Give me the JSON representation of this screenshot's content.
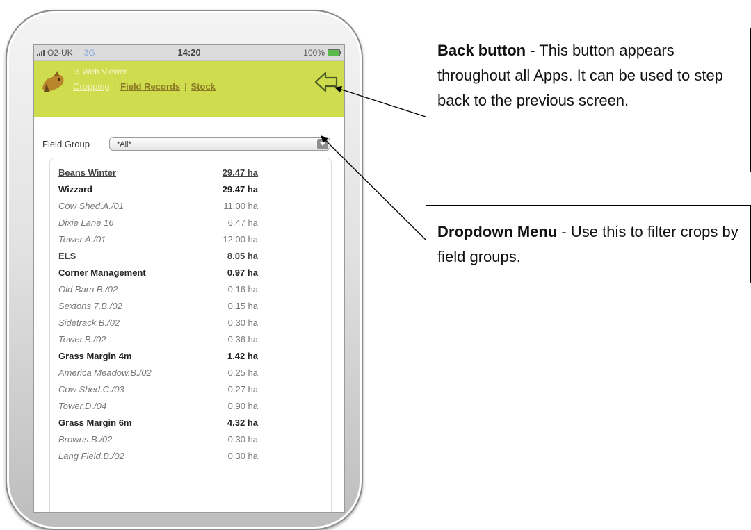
{
  "status_bar": {
    "carrier": "O2-UK",
    "network": "3G",
    "time": "14:20",
    "battery": "100%"
  },
  "app_header": {
    "title": "½ Web Viewer",
    "nav": {
      "cropping": "Cropping",
      "sep1": "|",
      "field_records": "Field Records",
      "sep2": "|",
      "stock": "Stock"
    }
  },
  "filter": {
    "label": "Field Group",
    "selected": "*All*"
  },
  "rows": [
    {
      "name": "Beans Winter",
      "area": "29.47 ha",
      "level": "group"
    },
    {
      "name": "Wizzard",
      "area": "29.47 ha",
      "level": "sub"
    },
    {
      "name": "Cow Shed.A./01",
      "area": "11.00 ha",
      "level": "field"
    },
    {
      "name": "Dixie Lane 16",
      "area": "6.47 ha",
      "level": "field"
    },
    {
      "name": "Tower.A./01",
      "area": "12.00 ha",
      "level": "field"
    },
    {
      "name": "ELS",
      "area": "8.05 ha",
      "level": "group"
    },
    {
      "name": "Corner Management",
      "area": "0.97 ha",
      "level": "sub"
    },
    {
      "name": "Old Barn.B./02",
      "area": "0.16 ha",
      "level": "field"
    },
    {
      "name": "Sextons 7.B./02",
      "area": "0.15 ha",
      "level": "field"
    },
    {
      "name": "Sidetrack.B./02",
      "area": "0.30 ha",
      "level": "field"
    },
    {
      "name": "Tower.B./02",
      "area": "0.36 ha",
      "level": "field"
    },
    {
      "name": "Grass Margin 4m",
      "area": "1.42 ha",
      "level": "sub"
    },
    {
      "name": "America Meadow.B./02",
      "area": "0.25 ha",
      "level": "field"
    },
    {
      "name": "Cow Shed.C./03",
      "area": "0.27 ha",
      "level": "field"
    },
    {
      "name": "Tower.D./04",
      "area": "0.90 ha",
      "level": "field"
    },
    {
      "name": "Grass Margin 6m",
      "area": "4.32 ha",
      "level": "sub"
    },
    {
      "name": "Browns.B./02",
      "area": "0.30 ha",
      "level": "field"
    },
    {
      "name": "Lang Field.B./02",
      "area": "0.30 ha",
      "level": "field"
    }
  ],
  "callouts": {
    "back": {
      "title": "Back button",
      "text": " - This button appears throughout all Apps. It can be used to step back to the previous screen."
    },
    "dropdown": {
      "title": "Dropdown Menu",
      "text": " - Use this to filter crops by field groups."
    }
  },
  "colors": {
    "header_bg": "#cfdc4e",
    "back_arrow": "#4a5a25"
  },
  "icons": {
    "back": "back-arrow-icon",
    "dropdown": "chevron-down-icon",
    "logo": "app-logo"
  }
}
